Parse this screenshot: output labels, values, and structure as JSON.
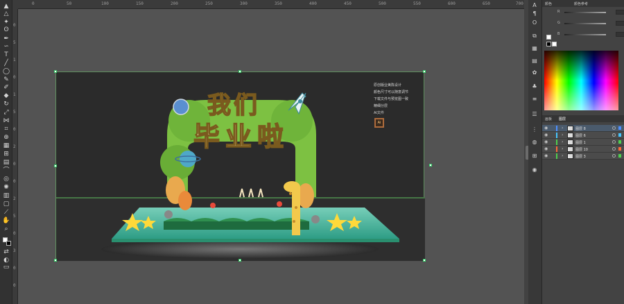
{
  "ruler": {
    "top_ticks": [
      "0",
      "50",
      "100",
      "150",
      "200",
      "250",
      "300",
      "350",
      "400",
      "450",
      "500",
      "550",
      "600",
      "650",
      "700"
    ],
    "left_ticks": [
      "0",
      "5",
      "1",
      "0",
      "1",
      "5",
      "0",
      "2",
      "0",
      "0",
      "2",
      "5",
      "0",
      "3",
      "0",
      "0"
    ]
  },
  "artboard": {
    "title_line1": "我们",
    "title_line2": "毕业啦",
    "notes": [
      "原创版业美陈设计",
      "颜色尺寸可以随意调节",
      "下载文件与预览图一致",
      "精细分层",
      "AI文件"
    ],
    "ai_badge": "Ai"
  },
  "colors": {
    "arch_green": "#7dc142",
    "stage_cyan": "#3fc4a8",
    "title_cream": "#fff3c0",
    "star_yellow": "#ffd93a",
    "selection_green": "#6ac66a",
    "rocket_white": "#e8f4f4"
  },
  "panel": {
    "top_tabs": [
      "颜色",
      "颜色参考"
    ],
    "sliders": [
      {
        "label": "R"
      },
      {
        "label": "G"
      },
      {
        "label": "B"
      }
    ],
    "layers_tabs": [
      "画板",
      "图层"
    ],
    "layers": [
      {
        "name": "图层 8",
        "color": "#4f8fff",
        "selected": true
      },
      {
        "name": "图层 6",
        "color": "#46c6ff",
        "selected": false
      },
      {
        "name": "图层 1",
        "color": "#4fcf4f",
        "selected": false
      },
      {
        "name": "图层 10",
        "color": "#ff6a3a",
        "selected": false
      },
      {
        "name": "图层 3",
        "color": "#4fcf4f",
        "selected": false
      }
    ]
  },
  "toolbar": {
    "tools": [
      "selection-tool",
      "direct-selection-tool",
      "magic-wand-tool",
      "lasso-tool",
      "pen-tool",
      "curvature-tool",
      "type-tool",
      "line-tool",
      "rectangle-tool",
      "paintbrush-tool",
      "shaper-tool",
      "eraser-tool",
      "rotate-tool",
      "scale-tool",
      "width-tool",
      "free-transform-tool",
      "shape-builder-tool",
      "perspective-tool",
      "mesh-tool",
      "gradient-tool",
      "eyedropper-tool",
      "blend-tool",
      "symbol-sprayer-tool",
      "column-graph-tool",
      "artboard-tool",
      "slice-tool",
      "hand-tool",
      "zoom-tool"
    ]
  }
}
